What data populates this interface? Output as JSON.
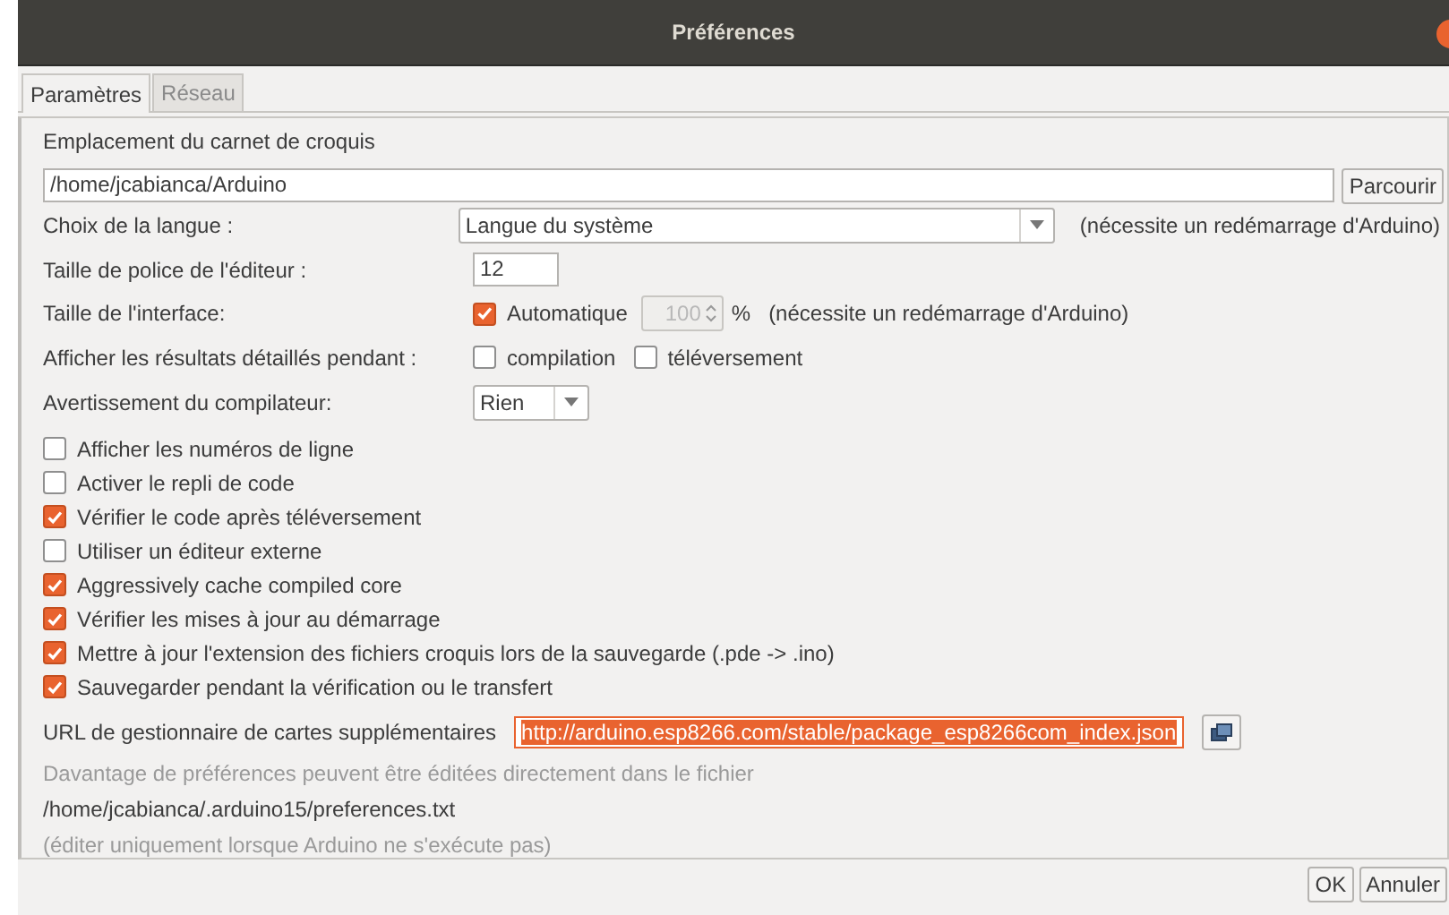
{
  "window": {
    "title": "Préférences"
  },
  "tabs": [
    {
      "label": "Paramètres",
      "selected": true
    },
    {
      "label": "Réseau",
      "selected": false
    }
  ],
  "sketchbook": {
    "label": "Emplacement du carnet de croquis",
    "value": "/home/jcabianca/Arduino",
    "button": "Parcourir"
  },
  "language": {
    "label": "Choix de la langue :",
    "value": "Langue du système",
    "note": "(nécessite un redémarrage d'Arduino)"
  },
  "font_size": {
    "label": "Taille de police de l'éditeur :",
    "value": "12"
  },
  "interface_size": {
    "label": "Taille de l'interface:",
    "auto_label": "Automatique",
    "checked": true,
    "value": "100",
    "unit": "%",
    "note": "(nécessite un redémarrage d'Arduino)"
  },
  "verbose": {
    "label": "Afficher les résultats détaillés pendant :",
    "options": [
      {
        "label": "compilation",
        "checked": false
      },
      {
        "label": "téléversement",
        "checked": false
      }
    ]
  },
  "warnings": {
    "label": "Avertissement du compilateur:",
    "value": "Rien"
  },
  "options": [
    {
      "label": "Afficher les numéros de ligne",
      "checked": false
    },
    {
      "label": "Activer le repli de code",
      "checked": false
    },
    {
      "label": "Vérifier le code après téléversement",
      "checked": true
    },
    {
      "label": "Utiliser un éditeur externe",
      "checked": false
    },
    {
      "label": "Aggressively cache compiled core",
      "checked": true
    },
    {
      "label": "Vérifier les mises à jour au démarrage",
      "checked": true
    },
    {
      "label": "Mettre à jour  l'extension des fichiers croquis lors de la sauvegarde (.pde -> .ino)",
      "checked": true
    },
    {
      "label": "Sauvegarder pendant la vérification ou le transfert",
      "checked": true
    }
  ],
  "boards_url": {
    "label": "URL de gestionnaire de cartes supplémentaires",
    "value": "http://arduino.esp8266.com/stable/package_esp8266com_index.json"
  },
  "info": [
    {
      "text": "Davantage de préférences peuvent être éditées directement dans le fichier",
      "kind": "hint"
    },
    {
      "text": "/home/jcabianca/.arduino15/preferences.txt",
      "kind": "path"
    },
    {
      "text": "(éditer uniquement lorsque Arduino ne s'exécute pas)",
      "kind": "hint"
    }
  ],
  "buttons": [
    "OK",
    "Annuler"
  ]
}
